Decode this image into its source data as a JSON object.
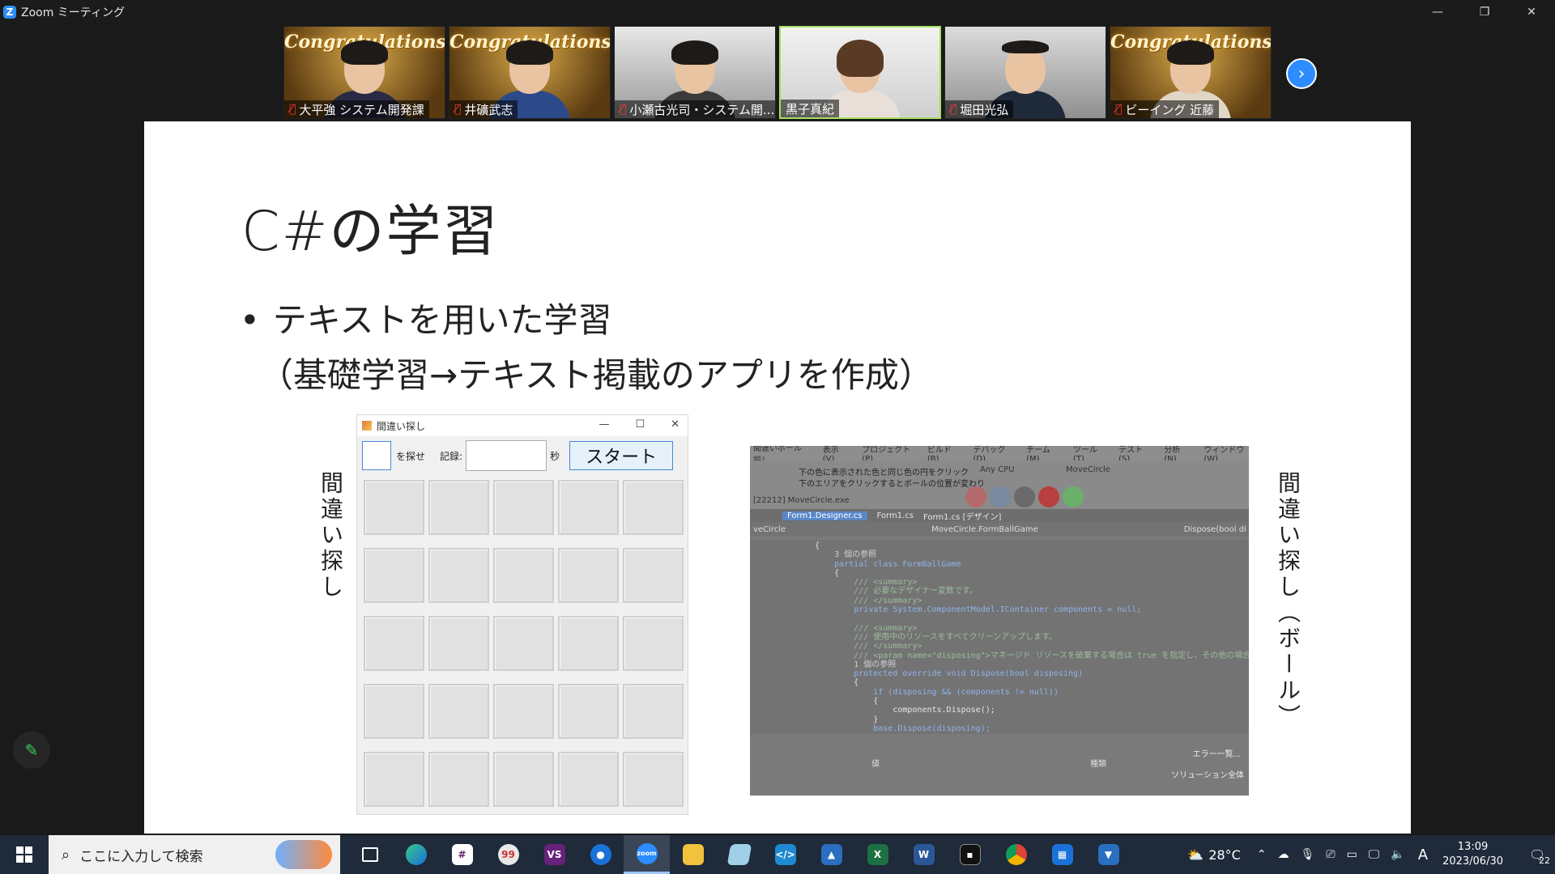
{
  "window": {
    "title": "Zoom ミーティング",
    "logo": "Z"
  },
  "participants": [
    {
      "name": "大平強 システム開発課",
      "muted": true,
      "bg": "congrats",
      "congrats_text": "Congratulations!"
    },
    {
      "name": "井礦武志",
      "muted": true,
      "bg": "congrats",
      "congrats_text": "Congratulations!"
    },
    {
      "name": "小瀬古光司・システム開...",
      "muted": true,
      "bg": "office"
    },
    {
      "name": "黒子真紀",
      "muted": false,
      "bg": "plain",
      "active": true
    },
    {
      "name": "堀田光弘",
      "muted": true,
      "bg": "office"
    },
    {
      "name": "ビーイング 近藤",
      "muted": true,
      "bg": "congrats",
      "congrats_text": "Congratulations!"
    }
  ],
  "slide": {
    "title": "C#の学習",
    "bullet": "テキストを用いた学習",
    "sub": "（基礎学習→テキスト掲載のアプリを作成）",
    "left_label": "間違い探し",
    "right_label": "間違い探し（ボール）"
  },
  "game_window": {
    "title": "間違い探し",
    "find_label": "を探せ",
    "record_label": "記録:",
    "sec_label": "秒",
    "start_label": "スタート"
  },
  "vs_window": {
    "menu": [
      "間違いボール探し",
      "表示(V)",
      "プロジェクト(P)",
      "ビルド(B)",
      "デバッグ(D)",
      "チーム(M)",
      "ツール(T)",
      "テスト(S)",
      "分析(N)",
      "ウィンドウ(W)"
    ],
    "toolbar_text_1": "下の色に表示された色と同じ色の円をクリック",
    "toolbar_text_2": "下のエリアをクリックするとボールの位置が変わり",
    "config": "Any CPU",
    "project": "MoveCircle",
    "process": "[22212] MoveCircle.exe",
    "tabs": [
      "Form1.Designer.cs",
      "Form1.cs",
      "Form1.cs [デザイン]"
    ],
    "nav": [
      "veCircle",
      "MoveCircle.FormBallGame",
      "Dispose(bool di"
    ],
    "code": [
      "{",
      "    3 個の参照",
      "    partial class FormBallGame",
      "    {",
      "        /// <summary>",
      "        /// 必要なデザイナー変数です。",
      "        /// </summary>",
      "        private System.ComponentModel.IContainer components = null;",
      "",
      "        /// <summary>",
      "        /// 使用中のリソースをすべてクリーンアップします。",
      "        /// </summary>",
      "        /// <param name=\"disposing\">マネージド リソースを破棄する場合は true を指定し、その他の場合は false を",
      "        1 個の参照",
      "        protected override void Dispose(bool disposing)",
      "        {",
      "            if (disposing && (components != null))",
      "            {",
      "                components.Dispose();",
      "            }",
      "            base.Dispose(disposing);"
    ],
    "err_label": "エラー一覧...",
    "sol_label": "ソリューション全体",
    "bottom_a": "値",
    "bottom_b": "種類"
  },
  "taskbar": {
    "search_placeholder": "ここに入力して検索",
    "weather_temp": "28°C",
    "ime": "A",
    "time": "13:09",
    "date": "2023/06/30",
    "notif_count": "22"
  },
  "colors": {
    "zoom_blue": "#2d8cff",
    "active_speaker": "#a6e060",
    "taskbar": "#1f2a3a"
  }
}
